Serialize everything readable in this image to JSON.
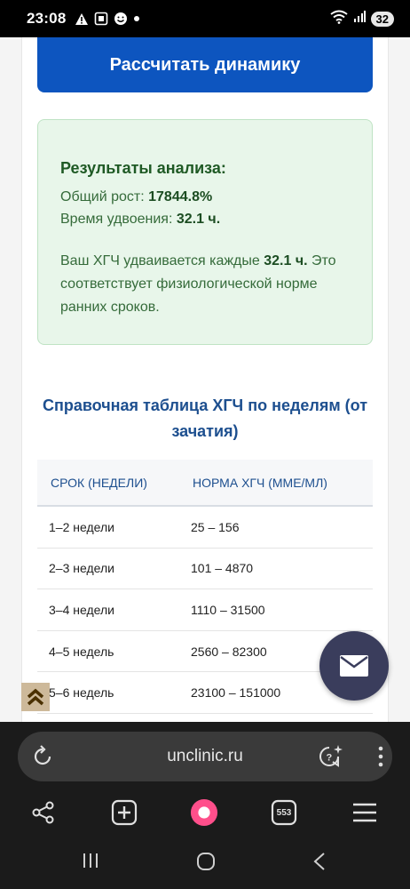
{
  "status_bar": {
    "time": "23:08",
    "battery": "32"
  },
  "page": {
    "calc_button_label": "Рассчитать динамику",
    "results": {
      "title": "Результаты анализа:",
      "growth_label": "Общий рост:",
      "growth_value": "17844.8%",
      "doubling_label": "Время удвоения:",
      "doubling_value": "32.1 ч.",
      "conclusion_pre": "Ваш ХГЧ удваивается каждые",
      "conclusion_value": "32.1 ч.",
      "conclusion_post": "Это соответствует физиологической норме ранних сроков."
    },
    "table_heading": "Справочная таблица ХГЧ по неделям (от зачатия)",
    "table": {
      "columns": [
        "СРОК (НЕДЕЛИ)",
        "НОРМА ХГЧ (МME/МЛ)"
      ],
      "rows": [
        [
          "1–2 недели",
          "25 – 156"
        ],
        [
          "2–3 недели",
          "101 – 4870"
        ],
        [
          "3–4 недели",
          "1110 – 31500"
        ],
        [
          "4–5 недель",
          "2560 – 82300"
        ],
        [
          "5–6 недель",
          "23100 – 151000"
        ]
      ]
    }
  },
  "browser": {
    "url": "unclinic.ru",
    "tabs_count": "553"
  },
  "colors": {
    "accent_blue": "#0d55bf",
    "results_bg": "#e8f6ea",
    "heading_blue": "#1d4f8f",
    "fab": "#3a3d5c"
  }
}
